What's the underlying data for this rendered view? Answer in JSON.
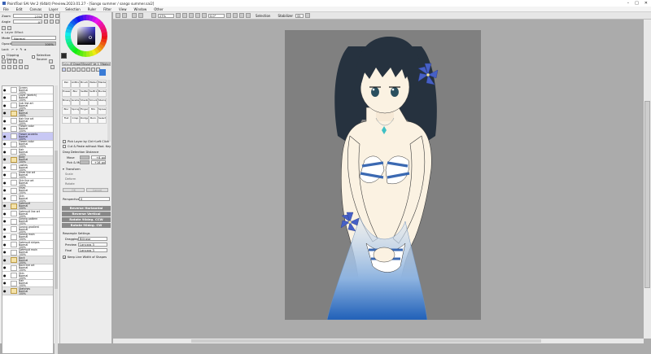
{
  "window": {
    "title": "PaintTool SAI Ver.2 (64bit) Preview.2023.01.27 - [Sango summer / sango summer.sai2]",
    "minimize": "–",
    "maximize": "□",
    "close": "✕"
  },
  "menu": [
    "File",
    "Edit",
    "Canvas",
    "Layer",
    "Selection",
    "Ruler",
    "Filter",
    "View",
    "Window",
    "Other"
  ],
  "left_panel": {
    "zoom_label": "Zoom",
    "zoom_value": "27%",
    "angle_label": "Angle",
    "angle_value": "0°",
    "layer_effect": "Layer Effect",
    "mode_label": "Mode",
    "mode_value": "Normal",
    "opacity_label": "Opacity",
    "opacity_value": "100%",
    "lock_label": "Lock",
    "clipping": "Clipping Group",
    "selection_source": "Selection Source",
    "layers": [
      {
        "name": "Screen",
        "mode": "Normal",
        "opacity": "100%",
        "type": "layer"
      },
      {
        "name": "Layer (sketch)",
        "mode": "Normal",
        "opacity": "100%",
        "type": "layer"
      },
      {
        "name": "Sub line art",
        "mode": "Normal",
        "opacity": "100%",
        "type": "layer"
      },
      {
        "name": "Hair",
        "mode": "Normal",
        "opacity": "100%",
        "type": "folder"
      },
      {
        "name": "Hair line art",
        "mode": "Normal",
        "opacity": "100%",
        "type": "layer"
      },
      {
        "name": "Flower color",
        "mode": "Normal",
        "opacity": "100%",
        "type": "layer"
      },
      {
        "name": "Flower accents",
        "mode": "Normal",
        "opacity": "100%",
        "type": "layer",
        "selected": true
      },
      {
        "name": "Flower color",
        "mode": "Normal",
        "opacity": "100%",
        "type": "layer"
      },
      {
        "name": "Hair",
        "mode": "Normal",
        "opacity": "100%",
        "type": "layer"
      },
      {
        "name": "Body",
        "mode": "Normal",
        "opacity": "100%",
        "type": "folder"
      },
      {
        "name": "Lashes",
        "mode": "Normal",
        "opacity": "100%",
        "type": "layer"
      },
      {
        "name": "Irises line art",
        "mode": "Normal",
        "opacity": "100%",
        "type": "layer"
      },
      {
        "name": "Skin line art",
        "mode": "Normal",
        "opacity": "100%",
        "type": "layer"
      },
      {
        "name": "Irises",
        "mode": "Normal",
        "opacity": "100%",
        "type": "layer"
      },
      {
        "name": "Skin",
        "mode": "Normal",
        "opacity": "100%",
        "type": "layer"
      },
      {
        "name": "Swimsuit",
        "mode": "Normal",
        "opacity": "100%",
        "type": "folder"
      },
      {
        "name": "Swimsuit line art",
        "mode": "Normal",
        "opacity": "100%",
        "type": "layer"
      },
      {
        "name": "Sarong pattern",
        "mode": "Normal",
        "opacity": "100%",
        "type": "layer"
      },
      {
        "name": "Sarong gradient",
        "mode": "Normal",
        "opacity": "100%",
        "type": "layer"
      },
      {
        "name": "Sarong main",
        "mode": "Normal",
        "opacity": "100%",
        "type": "layer"
      },
      {
        "name": "Swimsuit stripes",
        "mode": "Normal",
        "opacity": "100%",
        "type": "layer"
      },
      {
        "name": "Swimsuit main",
        "mode": "Normal",
        "opacity": "100%",
        "type": "layer"
      },
      {
        "name": "Back",
        "mode": "Normal",
        "opacity": "100%",
        "type": "folder"
      },
      {
        "name": "Back line art",
        "mode": "Normal",
        "opacity": "100%",
        "type": "layer"
      },
      {
        "name": "Skin",
        "mode": "Normal",
        "opacity": "100%",
        "type": "layer"
      },
      {
        "name": "Hair",
        "mode": "Normal",
        "opacity": "100%",
        "type": "layer"
      },
      {
        "name": "Sketches",
        "mode": "Normal",
        "opacity": "100%",
        "type": "folder"
      }
    ]
  },
  "tool_panel": {
    "tabs": [
      "Select",
      "Draw",
      "Brush",
      "Ve 1",
      "Water"
    ],
    "tools": [
      "Pen",
      "AirBrush",
      "Brush",
      "Water",
      "Marker",
      "Eraser",
      "Blur",
      "SelPen",
      "SelEras",
      "Bucket",
      "Binary",
      "Gradat",
      "Shading",
      "Smudge",
      "Stamp",
      "Blur",
      "Sponge",
      "Finger",
      "Mix",
      "Spread",
      "Flat",
      "Crisp",
      "Dodge",
      "Burn",
      "Select"
    ],
    "pick_layer": "Pick Layer by Ctrl+Left Click",
    "cut_paste": "Cut & Paste without Mod. Key",
    "drag_detection": "Drag Detection Distance",
    "move_label": "Move",
    "move_value": "+8 px",
    "pick_move_label": "Pick & Move",
    "pick_move_value": "+16 px",
    "transform": "Transform",
    "scale": "Scale",
    "deform": "Deform",
    "rotate": "Rotate",
    "ok": "OK",
    "cancel": "Cancel",
    "perspective": "Perspective",
    "perspective_value": "0",
    "reverse_h": "Reverse Horizontal",
    "reverse_v": "Reverse Vertical",
    "rotate_ccw": "Rotate 90deg. CCW",
    "rotate_cw": "Rotate 90deg. CW",
    "resample": "Resample Settings",
    "dragging_label": "Dragging",
    "dragging_value": "Bilinear",
    "finalize_label": "Preview",
    "finalize_value": "Lanczos 3",
    "final_label": "Final",
    "final_value": "Lanczos 3",
    "keep_width": "Keep Line Width of Shapes"
  },
  "toolbar": {
    "zoom_value": "27%",
    "angle_value": "0.0°",
    "selection_label": "Selection",
    "stabilizer_label": "Stabilizer",
    "stabilizer_value": "S5"
  },
  "colors": {
    "hair": "#2a3644",
    "skin": "#fbf2e2",
    "stripe": "#3b69b2",
    "flower": "#4660c6",
    "canvas_bg": "#808080",
    "sarong": "#2f6fc0"
  }
}
